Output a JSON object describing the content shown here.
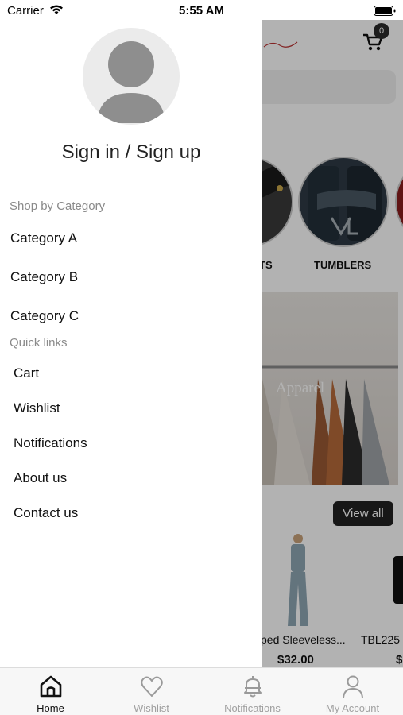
{
  "status_bar": {
    "carrier": "Carrier",
    "time": "5:55 AM"
  },
  "drawer": {
    "sign_in": "Sign in / Sign up",
    "shop_by_category_label": "Shop by Category",
    "categories": [
      "Category A",
      "Category B",
      "Category C"
    ],
    "quick_links_label": "Quick links",
    "quick_links": [
      "Cart",
      "Wishlist",
      "Notifications",
      "About us",
      "Contact us"
    ]
  },
  "background": {
    "cart_count": "0",
    "category_labels": [
      "TS",
      "TUMBLERS"
    ],
    "banner_text": "Apparel",
    "view_all": "View all",
    "products": [
      {
        "name": "ped Sleeveless...",
        "price": "$32.00"
      },
      {
        "name": "TBL225",
        "price": "$"
      }
    ]
  },
  "tab_bar": {
    "tabs": [
      {
        "label": "Home",
        "icon": "home-icon",
        "active": true
      },
      {
        "label": "Wishlist",
        "icon": "heart-icon",
        "active": false
      },
      {
        "label": "Notifications",
        "icon": "bell-icon",
        "active": false
      },
      {
        "label": "My Account",
        "icon": "person-icon",
        "active": false
      }
    ]
  },
  "colors": {
    "overlay": "#000000",
    "badge": "#2a2a2a",
    "active_tab": "#111111",
    "inactive_tab": "#a0a0a0"
  }
}
